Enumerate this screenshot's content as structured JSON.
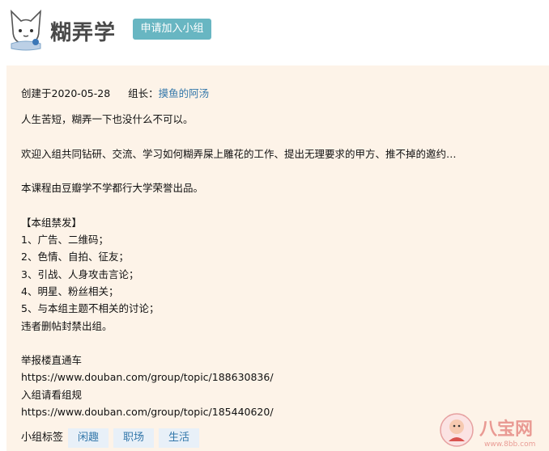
{
  "header": {
    "title": "糊弄学",
    "join_button": "申请加入小组"
  },
  "info": {
    "created": "创建于2020-05-28",
    "owner_label": "组长：",
    "owner_name": "摸鱼的阿汤"
  },
  "description": {
    "lines": [
      "人生苦短，糊弄一下也没什么不可以。",
      "",
      "欢迎入组共同钻研、交流、学习如何糊弄屎上雕花的工作、提出无理要求的甲方、推不掉的邀约…",
      "",
      "本课程由豆瓣学不学都行大学荣誉出品。",
      "",
      "【本组禁发】",
      "1、广告、二维码；",
      "2、色情、自拍、征友；",
      "3、引战、人身攻击言论；",
      "4、明星、粉丝相关；",
      "5、与本组主题不相关的讨论；",
      "违者删帖封禁出组。",
      "",
      "举报楼直通车",
      "https://www.douban.com/group/topic/188630836/",
      "入组请看组规",
      "https://www.douban.com/group/topic/185440620/"
    ]
  },
  "tags": {
    "label": "小组标签",
    "items": [
      "闲趣",
      "职场",
      "生活"
    ]
  },
  "watermark": {
    "text": "八宝网",
    "url": "www.8bb.com"
  },
  "colors": {
    "accent_button": "#68b6c2",
    "card_bg": "#fdf3e8",
    "link": "#3377aa",
    "tag_bg": "#e8f0f8",
    "watermark": "#d9534f"
  }
}
